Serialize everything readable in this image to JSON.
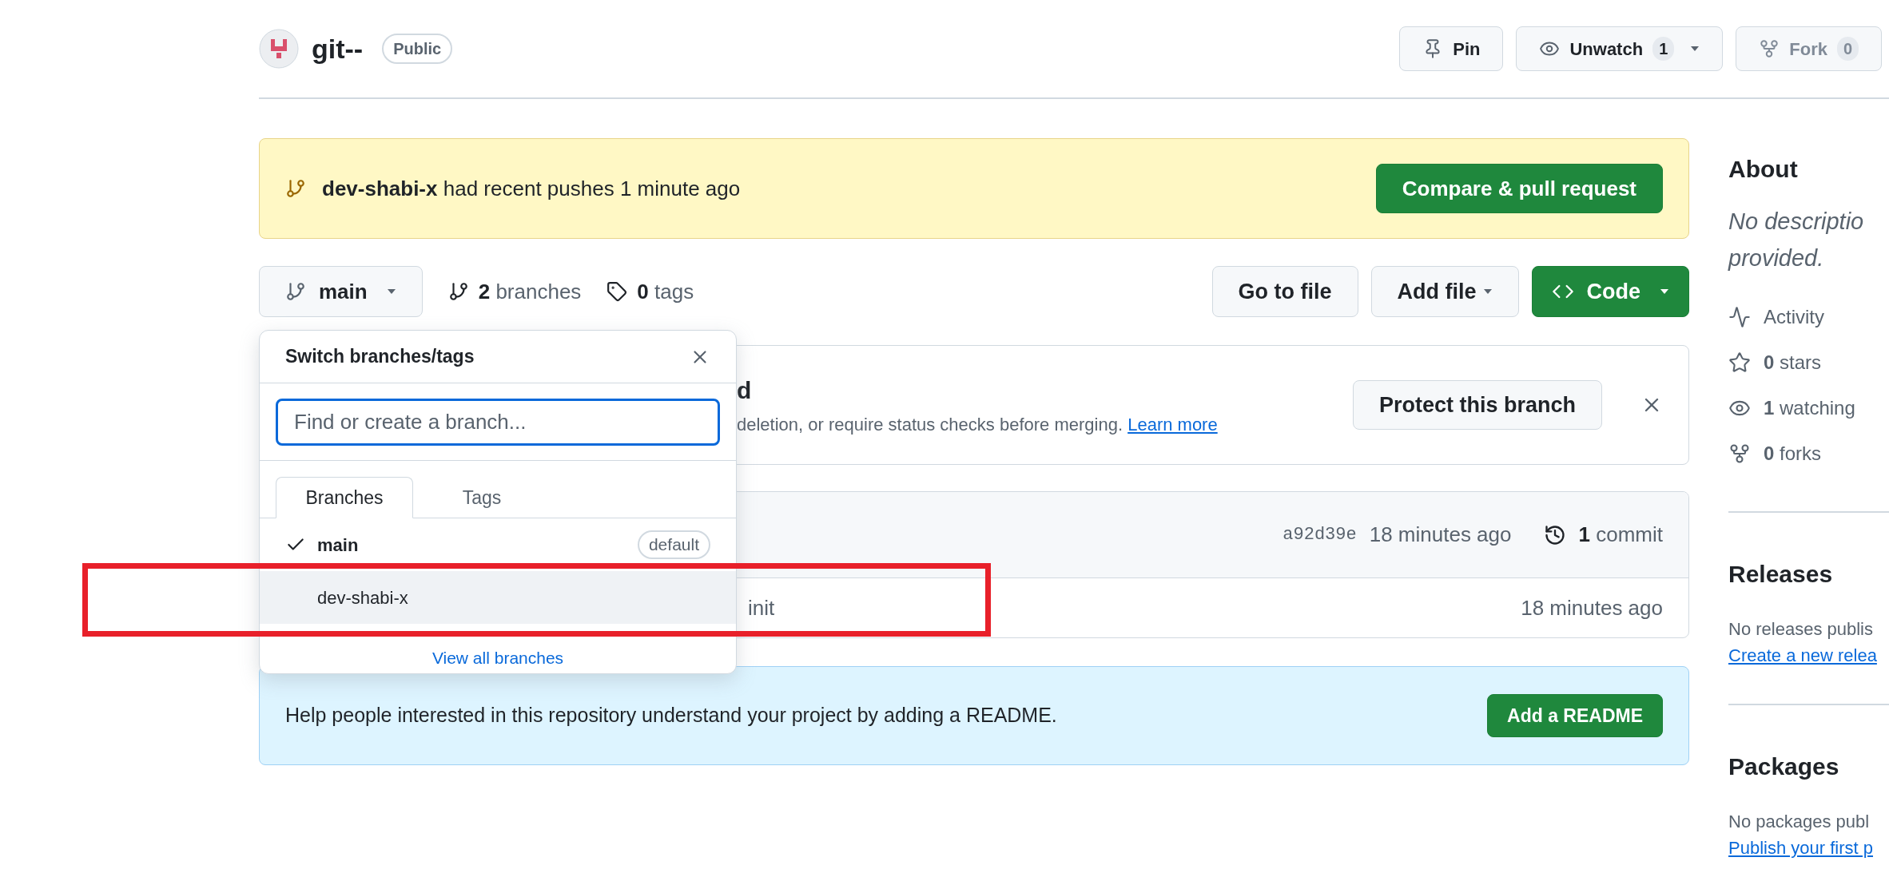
{
  "repo": {
    "name": "git--",
    "visibility": "Public"
  },
  "header_actions": [
    {
      "kind": "pin",
      "label": "Pin"
    },
    {
      "kind": "watch",
      "label": "Unwatch",
      "count": "1",
      "caret": true
    },
    {
      "kind": "fork",
      "label": "Fork",
      "count": "0",
      "caret": false
    }
  ],
  "push_banner": {
    "branch": "dev-shabi-x",
    "message": "had recent pushes 1 minute ago",
    "button": "Compare & pull request"
  },
  "branch_bar": {
    "branch": "main",
    "branches_count": "2",
    "branches_label": "branches",
    "tags_count": "0",
    "tags_label": "tags",
    "buttons": [
      {
        "kind": "plain",
        "label": "Go to file",
        "caret": false
      },
      {
        "kind": "plain",
        "label": "Add file",
        "caret": true
      },
      {
        "kind": "code",
        "label": "Code",
        "caret": true
      }
    ]
  },
  "protect_banner": {
    "title": "d",
    "description": "deletion, or require status checks before merging.",
    "link": "Learn more",
    "button": "Protect this branch"
  },
  "commit_box": {
    "sha": "a92d39e",
    "time": "18 minutes ago",
    "commit_count": "1",
    "commit_label": "commit",
    "files": [
      {
        "message": "init",
        "time": "18 minutes ago"
      }
    ]
  },
  "readme_banner": {
    "text": "Help people interested in this repository understand your project by adding a README.",
    "button": "Add a README"
  },
  "branch_dropdown": {
    "title": "Switch branches/tags",
    "search": {
      "placeholder": "Find or create a branch..."
    },
    "tabs": [
      {
        "label": "Branches",
        "selected": true
      },
      {
        "label": "Tags",
        "selected": false
      }
    ],
    "branches": [
      {
        "name": "main",
        "checked": true,
        "highlighted": false,
        "badge": "default"
      },
      {
        "name": "dev-shabi-x",
        "checked": false,
        "highlighted": true
      }
    ],
    "footer_link": "View all branches"
  },
  "annotation": {
    "kind": "highlight-rectangle",
    "color": "#e8202a"
  },
  "sidebar": {
    "about": {
      "title": "About",
      "description": [
        "No descriptio",
        "provided."
      ],
      "stats": [
        {
          "kind": "activity",
          "label": "Activity"
        },
        {
          "kind": "star",
          "count": "0",
          "label": "stars"
        },
        {
          "kind": "eye",
          "count": "1",
          "label": "watching"
        },
        {
          "kind": "fork",
          "count": "0",
          "label": "forks"
        }
      ]
    },
    "sections": [
      {
        "title": "Releases",
        "text": "No releases publis",
        "link": "Create a new relea"
      },
      {
        "title": "Packages",
        "text": "No packages publ",
        "link": "Publish your first p"
      }
    ]
  }
}
